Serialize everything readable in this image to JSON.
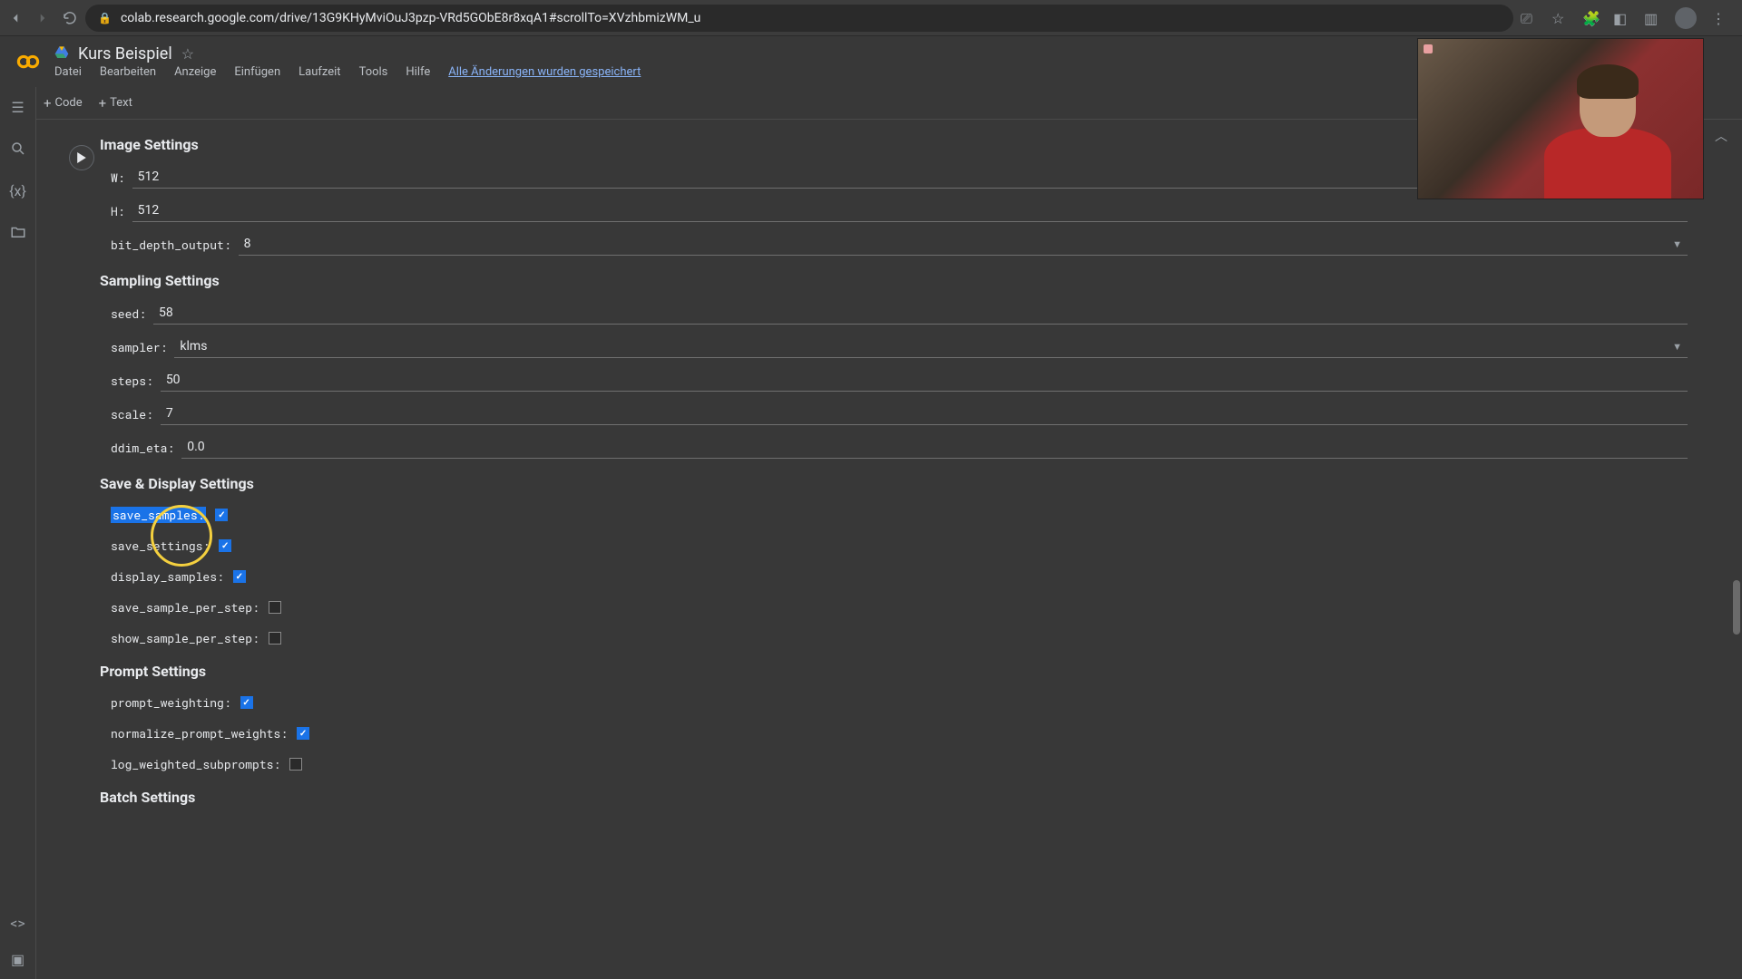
{
  "browser": {
    "url": "colab.research.google.com/drive/13G9KHyMviOuJ3pzp-VRd5GObE8r8xqA1#scrollTo=XVzhbmizWM_u"
  },
  "header": {
    "title": "Kurs Beispiel",
    "menu": [
      "Datei",
      "Bearbeiten",
      "Anzeige",
      "Einfügen",
      "Laufzeit",
      "Tools",
      "Hilfe"
    ],
    "save_status": "Alle Änderungen wurden gespeichert"
  },
  "toolbar": {
    "code": "Code",
    "text": "Text"
  },
  "sections": {
    "image": {
      "heading": "Image Settings",
      "fields": {
        "w_label": "W:",
        "w_val": "512",
        "h_label": "H:",
        "h_val": "512",
        "bit_label": "bit_depth_output:",
        "bit_val": "8"
      }
    },
    "sampling": {
      "heading": "Sampling Settings",
      "fields": {
        "seed_label": "seed:",
        "seed_val": "58",
        "sampler_label": "sampler:",
        "sampler_val": "klms",
        "steps_label": "steps:",
        "steps_val": "50",
        "scale_label": "scale:",
        "scale_val": "7",
        "ddim_label": "ddim_eta:",
        "ddim_val": "0.0"
      }
    },
    "save": {
      "heading": "Save & Display Settings",
      "checks": {
        "save_samples": "save_samples:",
        "save_settings": "save_settings:",
        "display_samples": "display_samples:",
        "save_per_step": "save_sample_per_step:",
        "show_per_step": "show_sample_per_step:"
      }
    },
    "prompt": {
      "heading": "Prompt Settings",
      "checks": {
        "weighting": "prompt_weighting:",
        "normalize": "normalize_prompt_weights:",
        "log": "log_weighted_subprompts:"
      }
    },
    "batch": {
      "heading": "Batch Settings"
    }
  }
}
